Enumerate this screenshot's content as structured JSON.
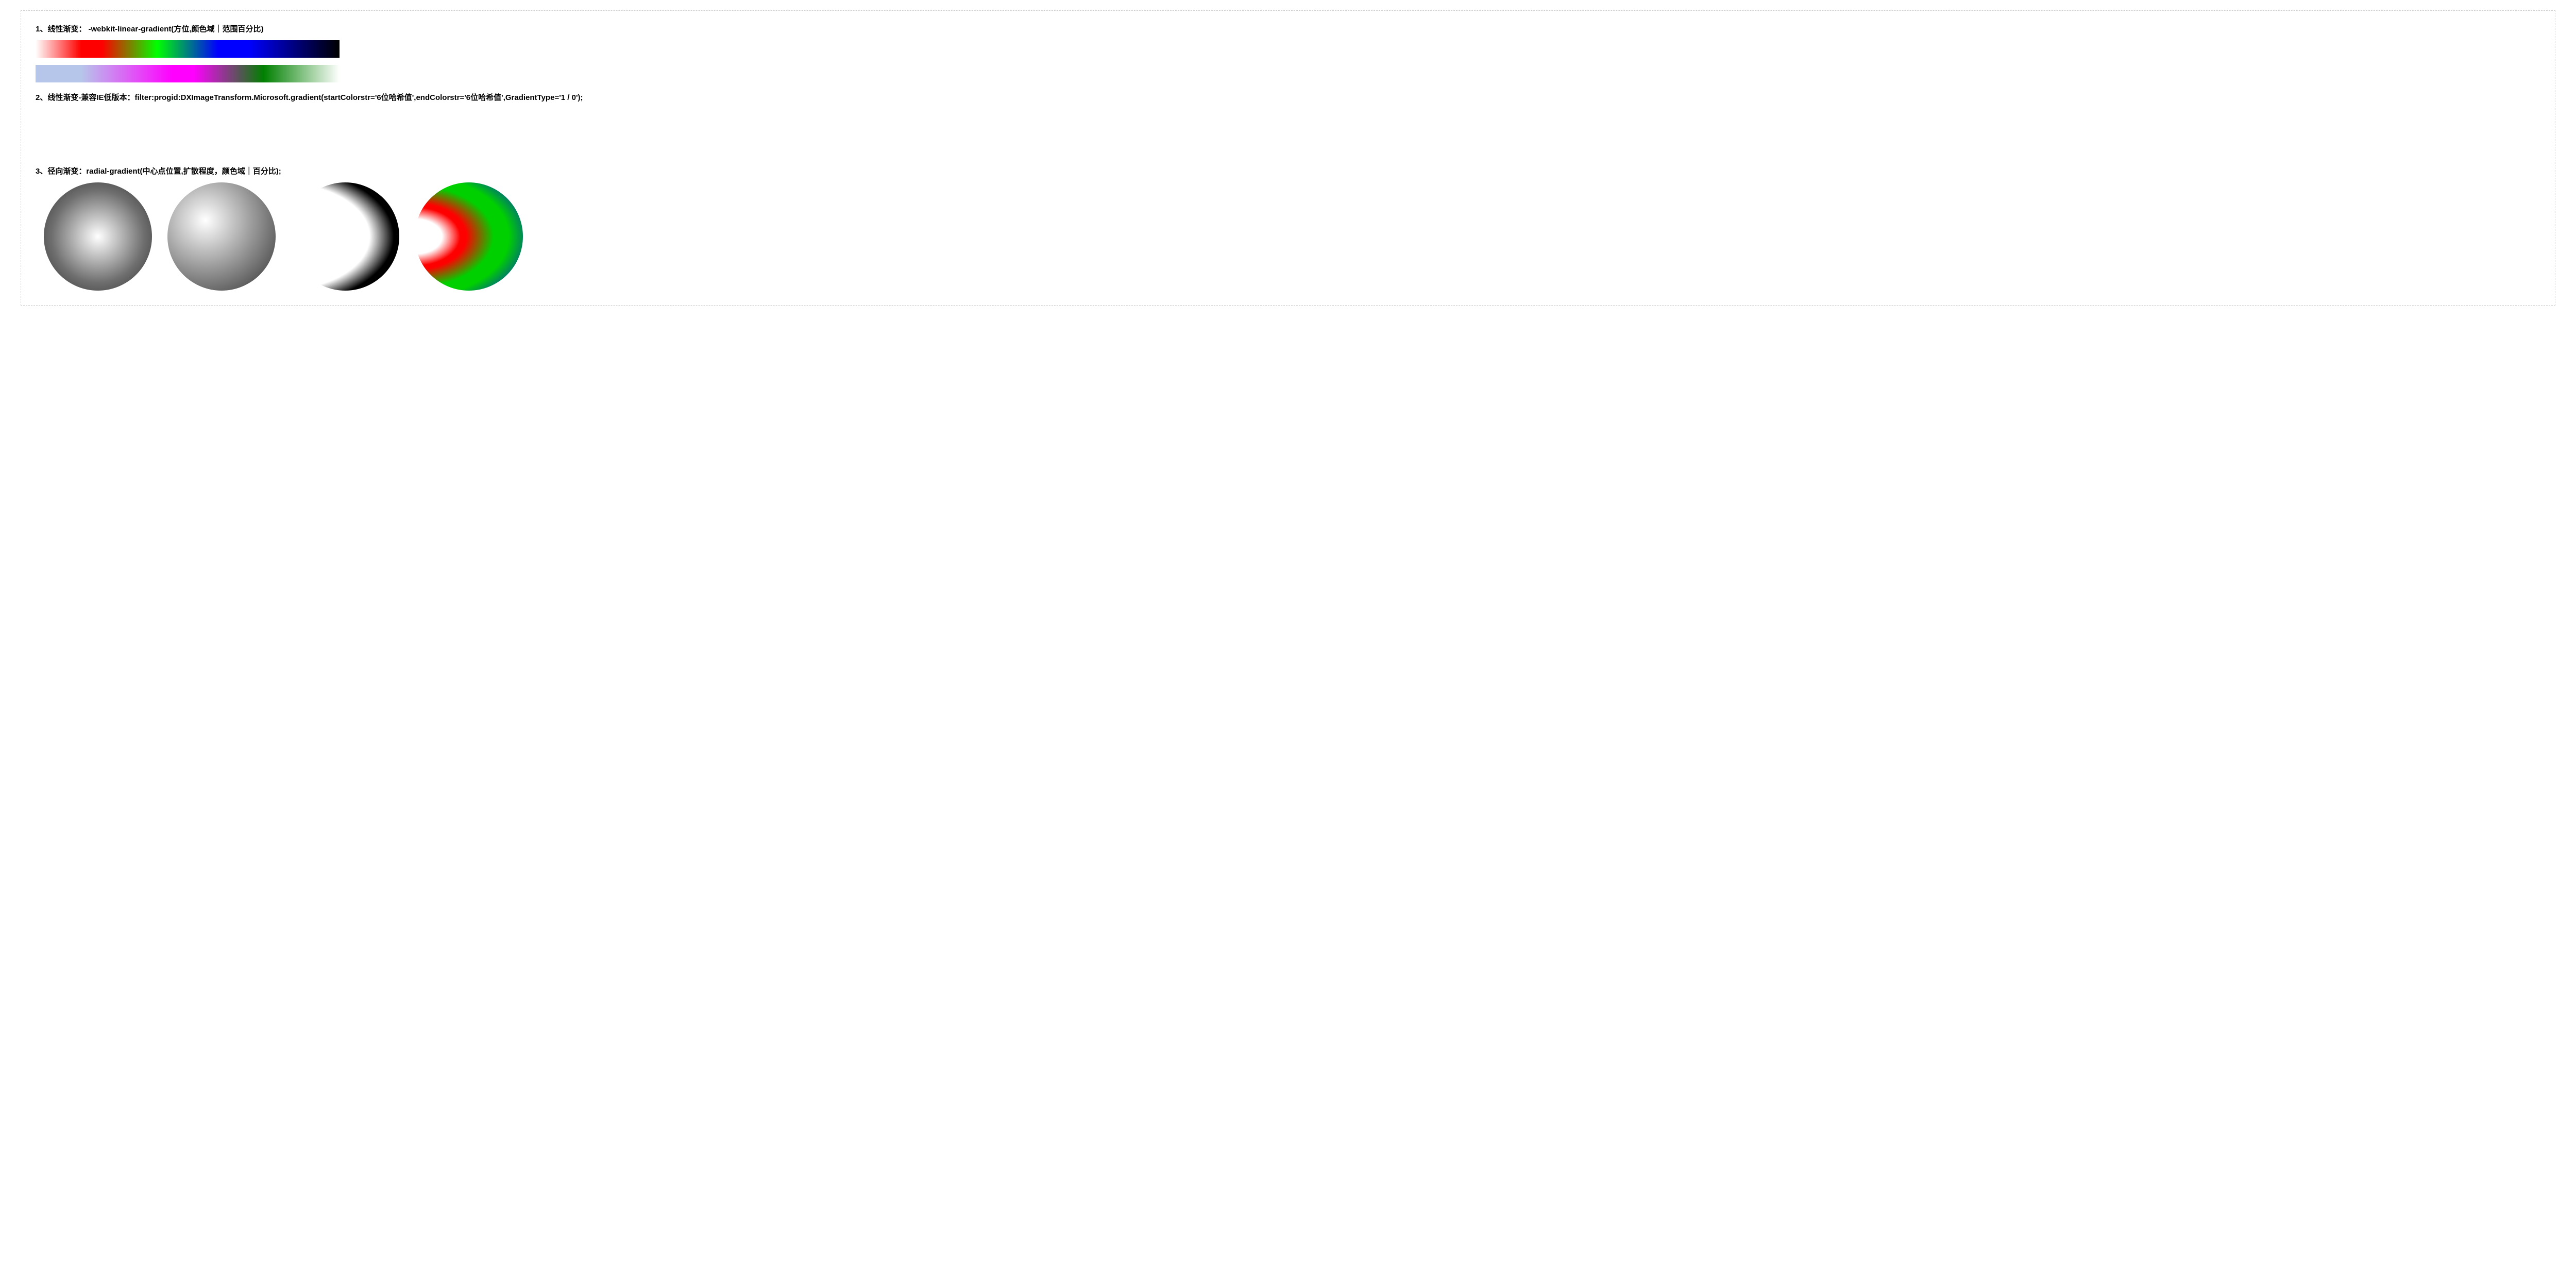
{
  "section1": {
    "heading": "1、线性渐变： -webkit-linear-gradient(方位,颜色域｜范围百分比)"
  },
  "section2": {
    "heading": "2、线性渐变-兼容IE低版本：filter:progid:DXImageTransform.Microsoft.gradient(startColorstr='6位哈希值',endColorstr='6位哈希值',GradientType='1 / 0');"
  },
  "section3": {
    "heading": "3、径向渐变：radial-gradient(中心点位置,扩散程度，颜色域｜百分比);"
  }
}
